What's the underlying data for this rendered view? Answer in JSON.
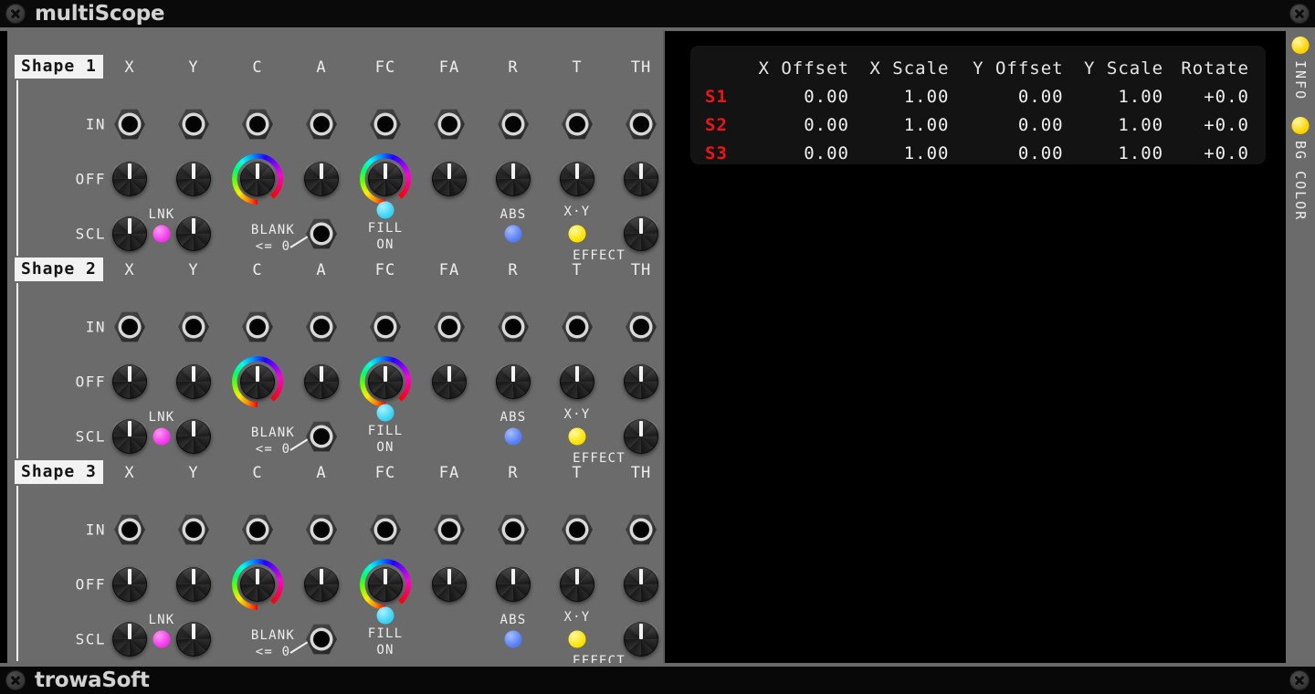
{
  "window": {
    "title": "multiScope",
    "footer_title": "trowaSoft",
    "close_icon": "close-icon"
  },
  "panel": {
    "column_headers": [
      "X",
      "Y",
      "C",
      "A",
      "FC",
      "FA",
      "R",
      "T",
      "TH"
    ],
    "row_labels": [
      "IN",
      "OFF",
      "SCL"
    ],
    "shapes": [
      {
        "tag": "Shape 1"
      },
      {
        "tag": "Shape 2"
      },
      {
        "tag": "Shape 3"
      }
    ],
    "controls": {
      "link_label": "LNK",
      "blank_label": "BLANK",
      "blank_compare": "<= 0",
      "fill_label_line1": "FILL",
      "fill_label_line2": "ON",
      "abs_label": "ABS",
      "xy_label": "X·Y",
      "effect_label": "EFFECT"
    },
    "colors": {
      "panel_bg": "#6b6b6b",
      "link_led": "#f53ced",
      "fill_led": "#3fd4f5",
      "abs_led": "#5b82f7",
      "xy_led": "#ffe400",
      "shape_tag_bg": "#f2f2f2",
      "shape_tag_fg": "#141414"
    }
  },
  "readout": {
    "columns": [
      "",
      "X Offset",
      "X Scale",
      "Y Offset",
      "Y Scale",
      "Rotate"
    ],
    "rows": [
      {
        "label": "S1",
        "x_offset": "0.00",
        "x_scale": "1.00",
        "y_offset": "0.00",
        "y_scale": "1.00",
        "rotate": "+0.0"
      },
      {
        "label": "S2",
        "x_offset": "0.00",
        "x_scale": "1.00",
        "y_offset": "0.00",
        "y_scale": "1.00",
        "rotate": "+0.0"
      },
      {
        "label": "S3",
        "x_offset": "0.00",
        "x_scale": "1.00",
        "y_offset": "0.00",
        "y_scale": "1.00",
        "rotate": "+0.0"
      }
    ],
    "label_color": "#ef1414",
    "bg": "#131313"
  },
  "sidebar": {
    "items": [
      {
        "label": "INFO",
        "dot_color": "#ffd500",
        "icon": "dot-indicator-icon"
      },
      {
        "label": "BG COLOR",
        "dot_color": "#ffd500",
        "icon": "dot-indicator-icon"
      }
    ]
  }
}
